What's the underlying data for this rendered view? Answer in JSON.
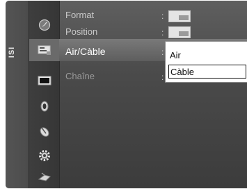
{
  "tab_label": "ISI",
  "icons": [
    "clock-icon",
    "channel-settings-icon",
    "picture-icon",
    "sound-icon",
    "satellite-icon",
    "gear-icon",
    "input-icon"
  ],
  "menu": {
    "format_label": "Format",
    "position_label": "Position",
    "air_cable_label": "Air/Càble",
    "chaine_label": "Chaîne",
    "colon": ":"
  },
  "dropdown": {
    "items": [
      {
        "label": "Air"
      },
      {
        "label": "Càble"
      }
    ],
    "selected": "Càble"
  },
  "colors": {
    "background": "#4a4a4a",
    "highlight": "#6e6e6e",
    "dropdown_bg": "#ffffff"
  }
}
